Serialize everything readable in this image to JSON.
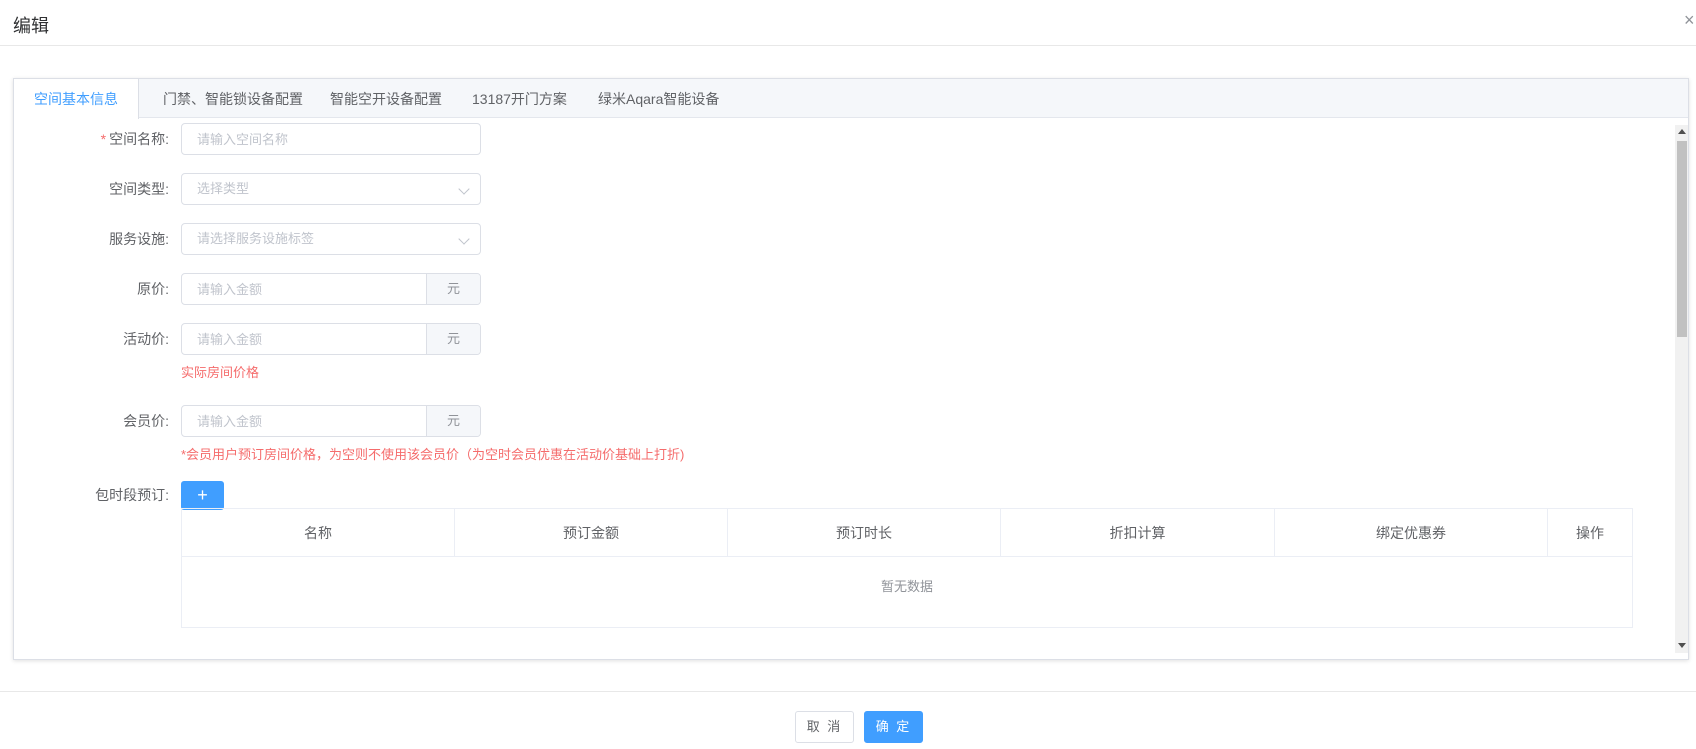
{
  "dialog": {
    "title": "编辑",
    "close_icon": "close-icon"
  },
  "tabs": [
    {
      "label": "空间基本信息",
      "active": true
    },
    {
      "label": "门禁、智能锁设备配置",
      "active": false
    },
    {
      "label": "智能空开设备配置",
      "active": false
    },
    {
      "label": "13187开门方案",
      "active": false
    },
    {
      "label": "绿米Aqara智能设备",
      "active": false
    }
  ],
  "form": {
    "required_mark": "*",
    "space_name": {
      "label": "空间名称:",
      "placeholder": "请输入空间名称"
    },
    "space_type": {
      "label": "空间类型:",
      "placeholder": "选择类型"
    },
    "facilities": {
      "label": "服务设施:",
      "placeholder": "请选择服务设施标签"
    },
    "original_price": {
      "label": "原价:",
      "placeholder": "请输入金额",
      "unit": "元"
    },
    "activity_price": {
      "label": "活动价:",
      "placeholder": "请输入金额",
      "unit": "元",
      "hint": "实际房间价格"
    },
    "member_price": {
      "label": "会员价:",
      "placeholder": "请输入金额",
      "unit": "元",
      "hint": "*会员用户预订房间价格，为空则不使用该会员价（为空时会员优惠在活动价基础上打折)"
    },
    "period_booking": {
      "label": "包时段预订:",
      "add_label": "+"
    }
  },
  "table": {
    "columns": [
      "名称",
      "预订金额",
      "预订时长",
      "折扣计算",
      "绑定优惠券",
      "操作"
    ],
    "empty_text": "暂无数据"
  },
  "footer": {
    "cancel_label": "取 消",
    "ok_label": "确 定"
  },
  "colors": {
    "primary": "#409eff",
    "danger": "#f56c6c",
    "border": "#dcdfe6"
  }
}
